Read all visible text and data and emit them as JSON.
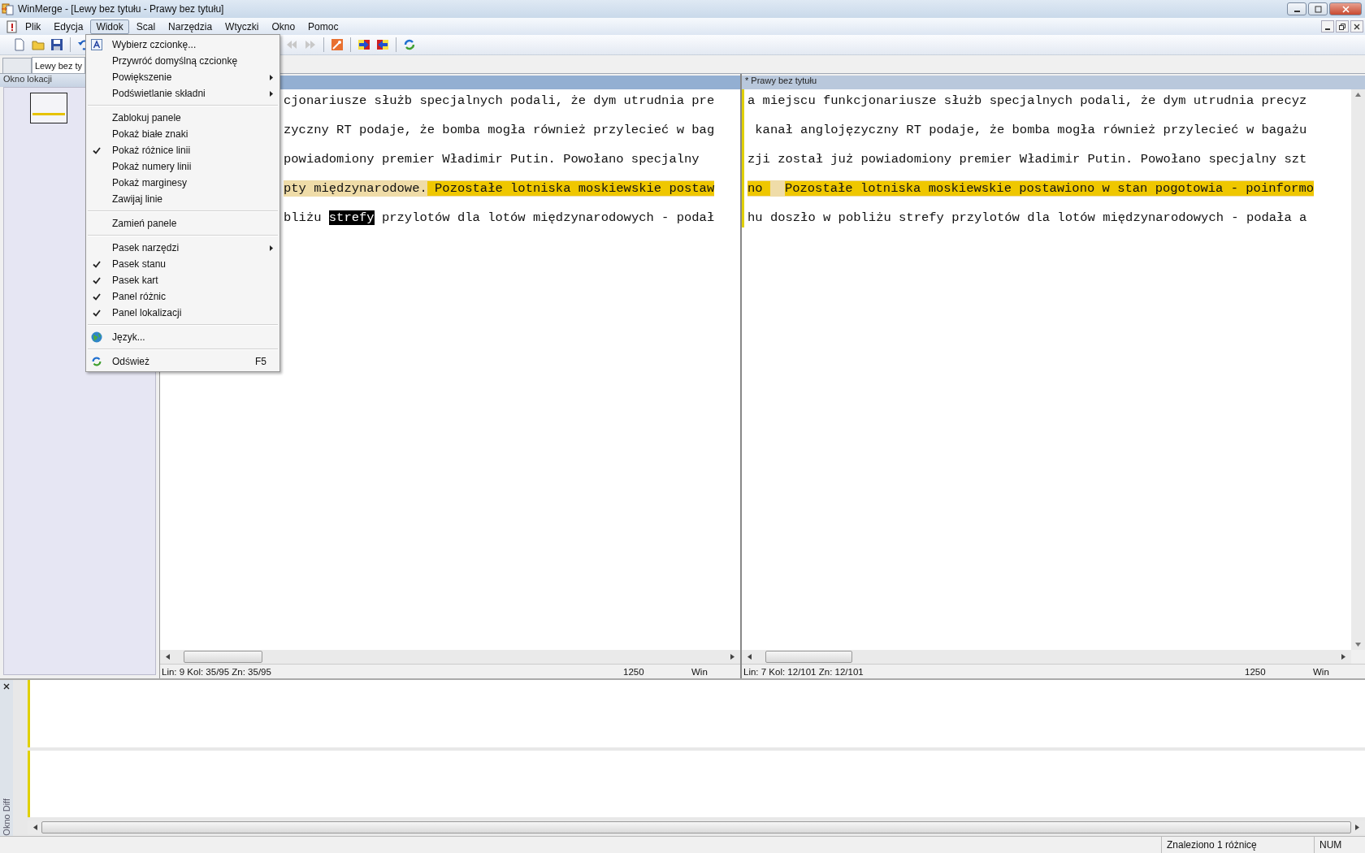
{
  "window": {
    "title": "WinMerge - [Lewy bez tytułu - Prawy bez tytułu]"
  },
  "menu_bar": [
    {
      "label": "Plik",
      "selected": false
    },
    {
      "label": "Edycja",
      "selected": false
    },
    {
      "label": "Widok",
      "selected": true
    },
    {
      "label": "Scal",
      "selected": false
    },
    {
      "label": "Narzędzia",
      "selected": false
    },
    {
      "label": "Wtyczki",
      "selected": false
    },
    {
      "label": "Okno",
      "selected": false
    },
    {
      "label": "Pomoc",
      "selected": false
    }
  ],
  "view_menu": [
    {
      "kind": "font",
      "label": "Wybierz czcionkę...",
      "checked": false,
      "submenu": false
    },
    {
      "kind": "item",
      "label": "Przywróć domyślną czcionkę",
      "checked": false,
      "submenu": false
    },
    {
      "kind": "item",
      "label": "Powiększenie",
      "checked": false,
      "submenu": true
    },
    {
      "kind": "item",
      "label": "Podświetlanie składni",
      "checked": false,
      "submenu": true
    },
    {
      "kind": "separator"
    },
    {
      "kind": "item",
      "label": "Zablokuj panele",
      "checked": false,
      "submenu": false
    },
    {
      "kind": "item",
      "label": "Pokaż białe znaki",
      "checked": false,
      "submenu": false
    },
    {
      "kind": "item",
      "label": "Pokaż różnice linii",
      "checked": true,
      "submenu": false
    },
    {
      "kind": "item",
      "label": "Pokaż numery linii",
      "checked": false,
      "submenu": false
    },
    {
      "kind": "item",
      "label": "Pokaż marginesy",
      "checked": false,
      "submenu": false
    },
    {
      "kind": "item",
      "label": "Zawijaj linie",
      "checked": false,
      "submenu": false
    },
    {
      "kind": "separator"
    },
    {
      "kind": "item",
      "label": "Zamień panele",
      "checked": false,
      "submenu": false
    },
    {
      "kind": "separator"
    },
    {
      "kind": "item",
      "label": "Pasek narzędzi",
      "checked": false,
      "submenu": true
    },
    {
      "kind": "item",
      "label": "Pasek stanu",
      "checked": true,
      "submenu": false
    },
    {
      "kind": "item",
      "label": "Pasek kart",
      "checked": true,
      "submenu": false
    },
    {
      "kind": "item",
      "label": "Panel różnic",
      "checked": true,
      "submenu": false
    },
    {
      "kind": "item",
      "label": "Panel lokalizacji",
      "checked": true,
      "submenu": false
    },
    {
      "kind": "separator"
    },
    {
      "kind": "language",
      "label": "Język...",
      "checked": false,
      "submenu": false
    },
    {
      "kind": "separator"
    },
    {
      "kind": "refresh",
      "label": "Odśwież",
      "checked": false,
      "submenu": false,
      "shortcut": "F5"
    }
  ],
  "tabs": [
    {
      "label": "Lewy bez ty",
      "selected": true
    }
  ],
  "location_pane": {
    "title": "Okno lokacji"
  },
  "left_pane": {
    "lines": [
      {
        "kind": "plain",
        "segments": [
          {
            "kind": "plain",
            "text": "cjonariusze służb specjalnych podali, że dym utrudnia pre"
          }
        ]
      },
      {
        "kind": "plain",
        "segments": [
          {
            "kind": "plain",
            "text": "zyczny RT podaje, że bomba mogła również przylecieć w bag"
          }
        ]
      },
      {
        "kind": "plain",
        "segments": [
          {
            "kind": "plain",
            "text": "powiadomiony premier Władimir Putin. Powołano specjalny"
          }
        ]
      },
      {
        "kind": "changed",
        "segments": [
          {
            "kind": "plain",
            "text": "pty międzynarodowe."
          },
          {
            "kind": "word",
            "text": " Pozostałe lotniska moskiewskie postaw"
          }
        ]
      },
      {
        "kind": "plain",
        "segments": [
          {
            "kind": "plain",
            "text": "bliżu "
          },
          {
            "kind": "selected",
            "text": "strefy"
          },
          {
            "kind": "plain",
            "text": " przylotów dla lotów międzynarodowych - podał"
          }
        ]
      }
    ],
    "status": {
      "position": "Lin: 9  Kol: 35/95  Zn: 35/95",
      "codepage": "1250",
      "eol": "Win"
    }
  },
  "right_pane": {
    "title": "* Prawy bez tytułu",
    "lines": [
      {
        "kind": "plain",
        "segments": [
          {
            "kind": "plain",
            "text": "a miejscu funkcjonariusze służb specjalnych podali, że dym utrudnia precyz"
          }
        ]
      },
      {
        "kind": "plain",
        "segments": [
          {
            "kind": "plain",
            "text": " kanał anglojęzyczny RT podaje, że bomba mogła również przylecieć w bagażu"
          }
        ]
      },
      {
        "kind": "plain",
        "segments": [
          {
            "kind": "plain",
            "text": "zji został już powiadomiony premier Władimir Putin. Powołano specjalny szt"
          }
        ]
      },
      {
        "kind": "changed",
        "segments": [
          {
            "kind": "word",
            "text": "no "
          },
          {
            "kind": "gap"
          },
          {
            "kind": "word",
            "text": "Pozostałe lotniska moskiewskie postawiono w stan pogotowia - poinformo"
          }
        ]
      },
      {
        "kind": "plain",
        "segments": [
          {
            "kind": "plain",
            "text": "hu doszło w pobliżu strefy przylotów dla lotów międzynarodowych - podała a"
          }
        ]
      }
    ],
    "status": {
      "position": "Lin: 7  Kol: 12/101  Zn: 12/101",
      "codepage": "1250",
      "eol": "Win"
    }
  },
  "diff_pane": {
    "title": "Okno Diff"
  },
  "status_bar": {
    "message": "Znaleziono 1 różnicę",
    "num": "NUM"
  }
}
